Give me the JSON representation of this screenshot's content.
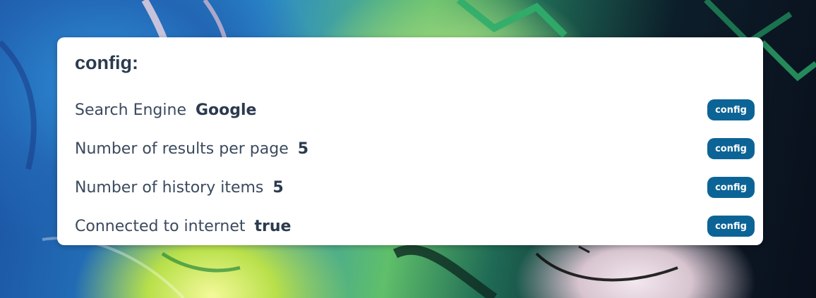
{
  "panel": {
    "title": "config:",
    "rows": [
      {
        "label": "Search Engine",
        "value": "Google",
        "button_label": "config"
      },
      {
        "label": "Number of results per page",
        "value": "5",
        "button_label": "config"
      },
      {
        "label": "Number of history items",
        "value": "5",
        "button_label": "config"
      },
      {
        "label": "Connected to internet",
        "value": "true",
        "button_label": "config"
      }
    ]
  },
  "colors": {
    "button_bg": "#0c6496",
    "text_dark": "#2b3a4e",
    "card_bg": "#ffffff"
  }
}
